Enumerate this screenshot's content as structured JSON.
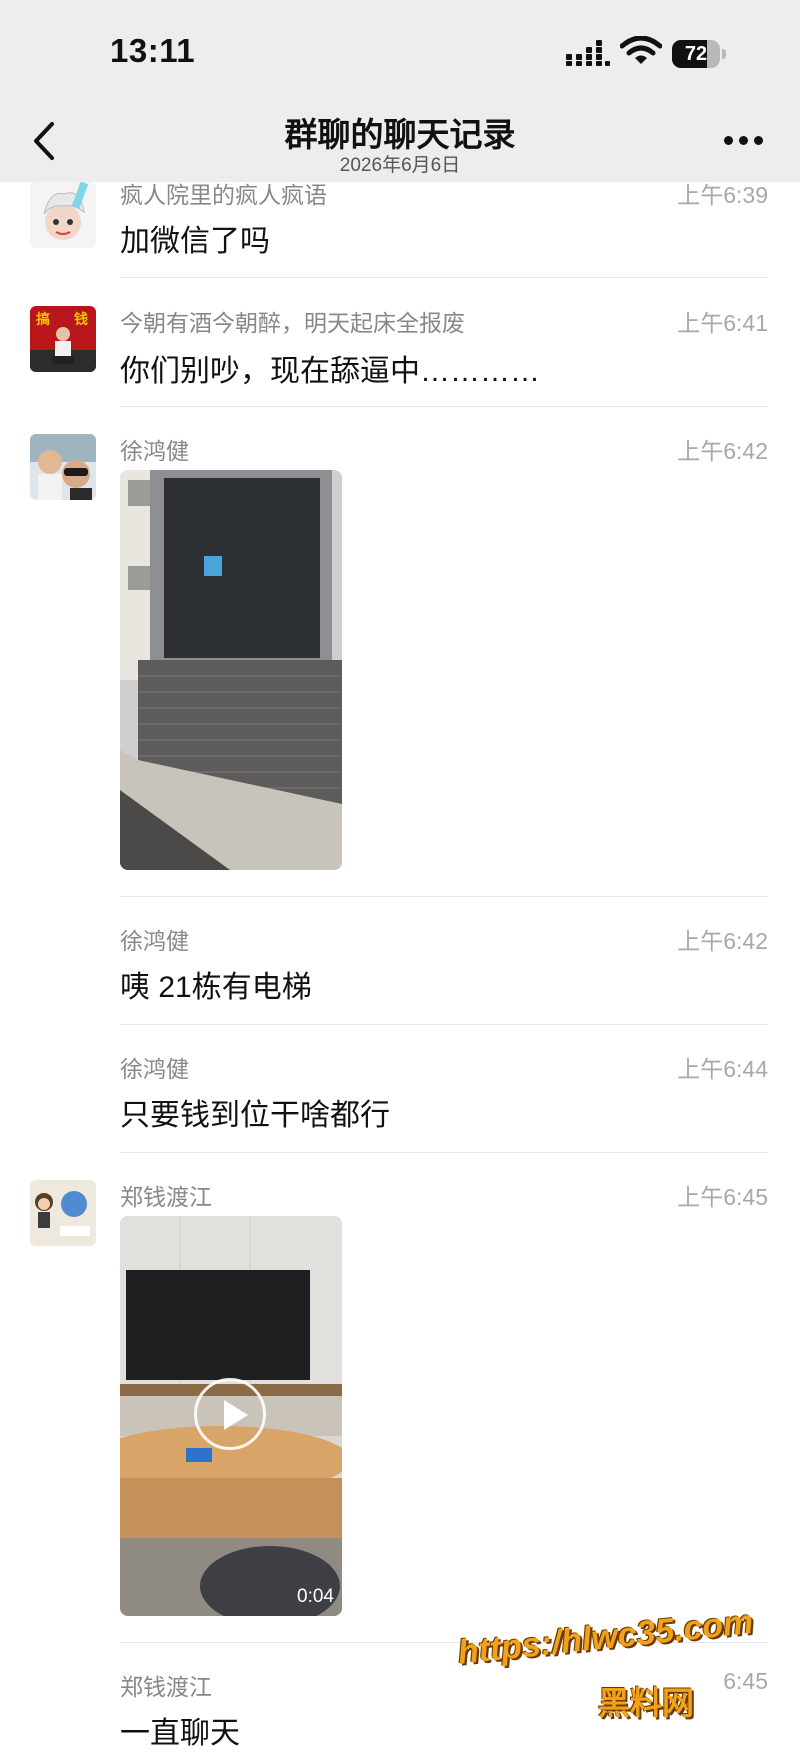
{
  "status_bar": {
    "time": "13:11",
    "battery": "72",
    "battery_level": 0.72
  },
  "nav": {
    "title": "群聊的聊天记录",
    "subtitle": "2026年6月6日"
  },
  "messages": [
    {
      "sender": "疯人院里的疯人疯语",
      "time": "上午6:39",
      "text": "加微信了吗"
    },
    {
      "sender": "今朝有酒今朝醉，明天起床全报废",
      "time": "上午6:41",
      "text": "你们别吵，现在舔逼中…………"
    },
    {
      "sender": "徐鸿健",
      "time": "上午6:42",
      "type": "image"
    },
    {
      "sender": "徐鸿健",
      "time": "上午6:42",
      "text": "咦 21栋有电梯"
    },
    {
      "sender": "徐鸿健",
      "time": "上午6:44",
      "text": "只要钱到位干啥都行"
    },
    {
      "sender": "郑钱渡江",
      "time": "上午6:45",
      "type": "video",
      "duration": "0:04"
    },
    {
      "sender": "郑钱渡江",
      "time": "6:45",
      "text": "一直聊天"
    }
  ],
  "watermark": {
    "url": "https:/hlwc35.com",
    "name": "黑料网"
  }
}
